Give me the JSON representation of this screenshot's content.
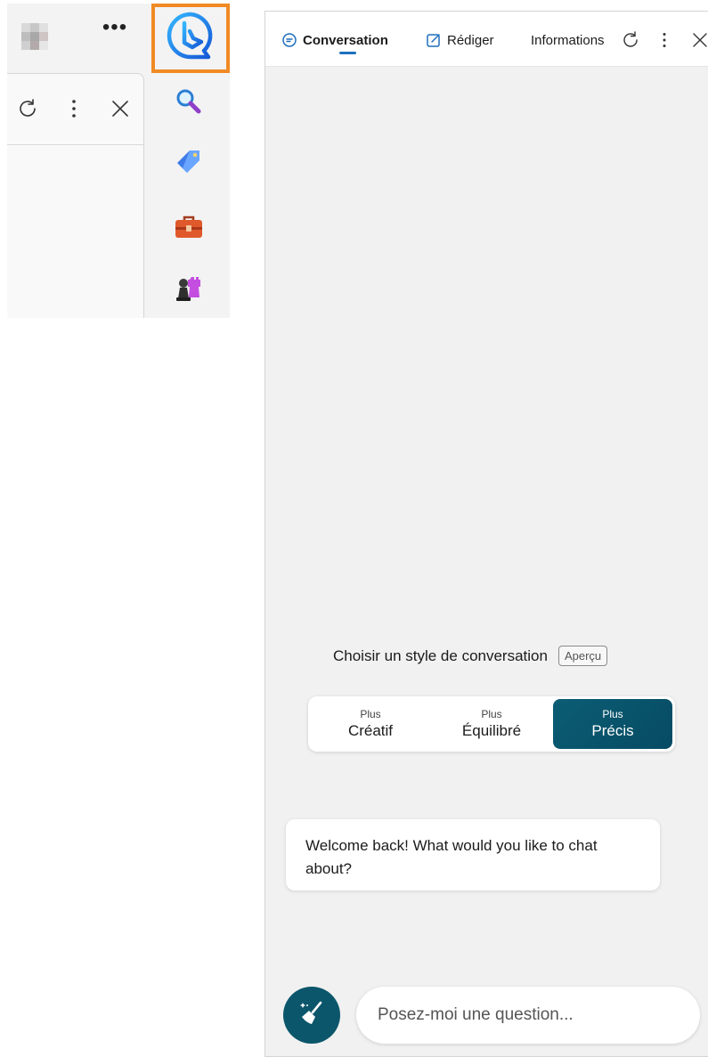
{
  "tabs": [
    {
      "label": "Conversation",
      "icon": "chat-bubble-icon",
      "active": true
    },
    {
      "label": "Rédiger",
      "icon": "compose-icon",
      "active": false
    },
    {
      "label": "Informations",
      "icon": "",
      "active": false
    }
  ],
  "header_buttons": [
    "refresh-icon",
    "more-vertical-icon",
    "close-icon"
  ],
  "left_toolbar_icons": [
    "more-horizontal-icon",
    "refresh-icon",
    "more-vertical-icon",
    "close-icon"
  ],
  "sidebar_icons": [
    "bing-icon",
    "search-icon",
    "tag-icon",
    "toolbox-icon",
    "chess-icon"
  ],
  "style_section": {
    "label": "Choisir un style de conversation",
    "badge": "Aperçu",
    "options": [
      {
        "small": "Plus",
        "big": "Créatif",
        "active": false
      },
      {
        "small": "Plus",
        "big": "Équilibré",
        "active": false
      },
      {
        "small": "Plus",
        "big": "Précis",
        "active": true
      }
    ]
  },
  "welcome_message": "Welcome back! What would you like to chat about?",
  "input": {
    "placeholder": "Posez-moi une question..."
  },
  "colors": {
    "accent": "#0b566b",
    "active_style": "#064b63",
    "highlight_border": "#f08a24",
    "tab_underline": "#1f6fbf"
  }
}
